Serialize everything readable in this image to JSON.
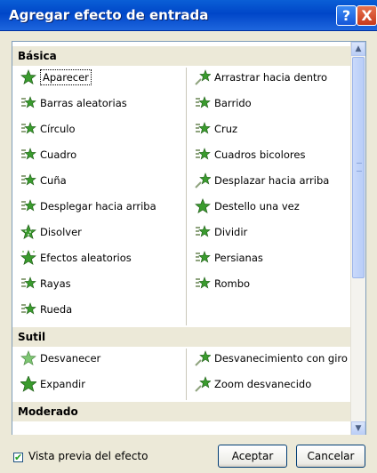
{
  "window": {
    "title": "Agregar efecto de entrada"
  },
  "titlebar_buttons": {
    "help": "?",
    "close": "X"
  },
  "sections": [
    {
      "header": "Básica",
      "left": [
        {
          "label": "Aparecer",
          "icon": "star-green-icon",
          "selected": true
        },
        {
          "label": "Barras aleatorias",
          "icon": "star-bars-icon"
        },
        {
          "label": "Círculo",
          "icon": "star-bars-icon"
        },
        {
          "label": "Cuadro",
          "icon": "star-bars-icon"
        },
        {
          "label": "Cuña",
          "icon": "star-bars-icon"
        },
        {
          "label": "Desplegar hacia arriba",
          "icon": "star-bars-icon"
        },
        {
          "label": "Disolver",
          "icon": "star-dots-icon"
        },
        {
          "label": "Efectos aleatorios",
          "icon": "star-sparkle-icon"
        },
        {
          "label": "Rayas",
          "icon": "star-bars-icon"
        },
        {
          "label": "Rueda",
          "icon": "star-bars-icon"
        }
      ],
      "right": [
        {
          "label": "Arrastrar hacia dentro",
          "icon": "star-fly-icon"
        },
        {
          "label": "Barrido",
          "icon": "star-bars-icon"
        },
        {
          "label": "Cruz",
          "icon": "star-bars-icon"
        },
        {
          "label": "Cuadros bicolores",
          "icon": "star-bars-icon"
        },
        {
          "label": "Desplazar hacia arriba",
          "icon": "star-fly-icon"
        },
        {
          "label": "Destello una vez",
          "icon": "star-green-icon"
        },
        {
          "label": "Dividir",
          "icon": "star-bars-icon"
        },
        {
          "label": "Persianas",
          "icon": "star-bars-icon"
        },
        {
          "label": "Rombo",
          "icon": "star-bars-icon"
        }
      ]
    },
    {
      "header": "Sutil",
      "left": [
        {
          "label": "Desvanecer",
          "icon": "star-fade-icon"
        },
        {
          "label": "Expandir",
          "icon": "star-expand-icon"
        }
      ],
      "right": [
        {
          "label": "Desvanecimiento con giro",
          "icon": "star-fly-icon"
        },
        {
          "label": "Zoom desvanecido",
          "icon": "star-fly-icon"
        }
      ]
    },
    {
      "header": "Moderado",
      "left": [],
      "right": []
    }
  ],
  "footer": {
    "preview_label": "Vista previa del efecto",
    "preview_checked": true,
    "ok_label": "Aceptar",
    "cancel_label": "Cancelar"
  }
}
